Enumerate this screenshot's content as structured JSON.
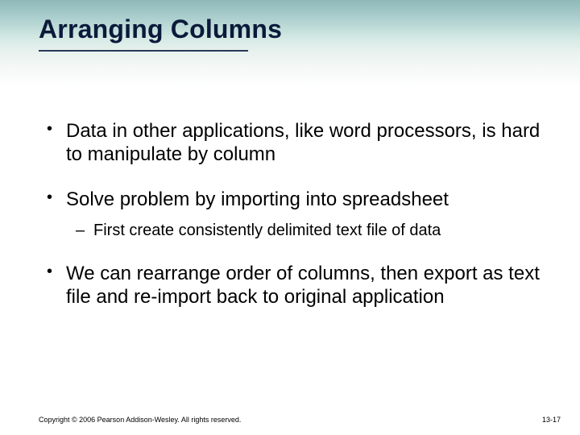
{
  "slide": {
    "title": "Arranging Columns",
    "bullets": [
      {
        "text": "Data in other applications, like word processors, is hard to manipulate by column"
      },
      {
        "text": "Solve problem by importing into spreadsheet",
        "sub": [
          {
            "text": "First create consistently delimited text file of data"
          }
        ]
      },
      {
        "text": "We can rearrange order of columns, then export as text file and re-import back to original application"
      }
    ]
  },
  "footer": {
    "copyright": "Copyright © 2006 Pearson Addison-Wesley. All rights reserved.",
    "page": "13-17"
  }
}
